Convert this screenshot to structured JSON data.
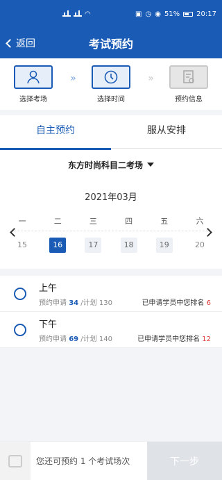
{
  "status": {
    "battery": "51%",
    "time": "20:17"
  },
  "nav": {
    "back_label": "返回",
    "title": "考试预约"
  },
  "steps": [
    {
      "label": "选择考场",
      "icon": "user-icon",
      "state": "active"
    },
    {
      "label": "选择时间",
      "icon": "clock-icon",
      "state": "active"
    },
    {
      "label": "预约信息",
      "icon": "document-icon",
      "state": "inactive"
    }
  ],
  "tabs": [
    {
      "label": "自主预约",
      "active": true
    },
    {
      "label": "服从安排",
      "active": false
    }
  ],
  "venue": {
    "selected": "东方时尚科目二考场"
  },
  "calendar": {
    "month": "2021年03月",
    "weekdays": [
      "一",
      "二",
      "三",
      "四",
      "五",
      "六"
    ],
    "dates": [
      "15",
      "16",
      "17",
      "18",
      "19",
      "20"
    ],
    "selected_date": "16"
  },
  "slots": [
    {
      "name": "上午",
      "applied_label": "预约申请",
      "applied": "34",
      "plan_label": "/计划",
      "plan": "130",
      "rank_label": "已申请学员中您排名",
      "rank": "6"
    },
    {
      "name": "下午",
      "applied_label": "预约申请",
      "applied": "69",
      "plan_label": "/计划",
      "plan": "140",
      "rank_label": "已申请学员中您排名",
      "rank": "12"
    }
  ],
  "bottom": {
    "remaining_text": "您还可预约 1 个考试场次",
    "next_label": "下一步"
  },
  "colors": {
    "primary": "#1a5bb5",
    "rank": "#e03a3a"
  }
}
